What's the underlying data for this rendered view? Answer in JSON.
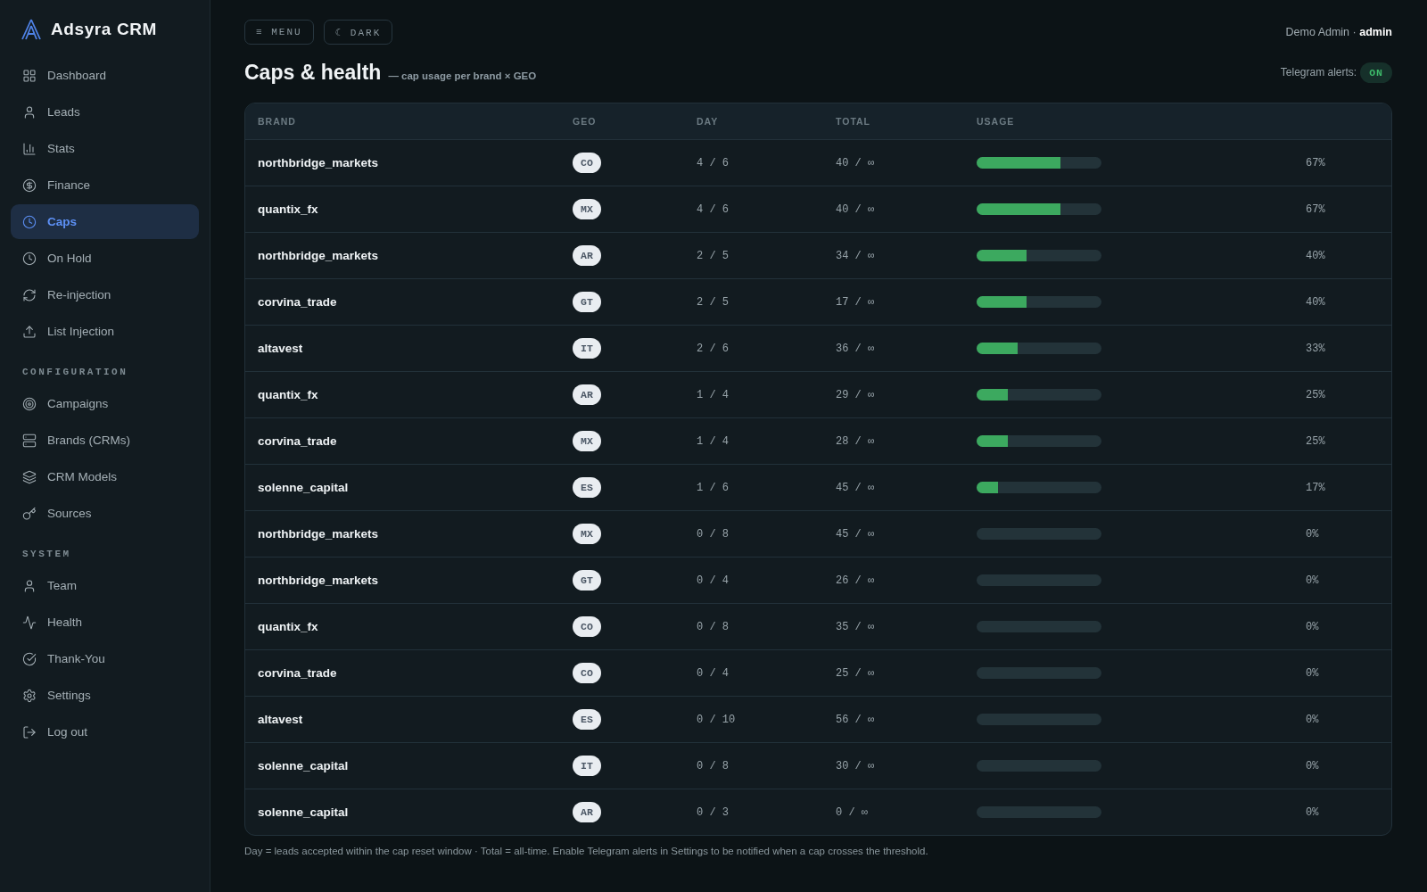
{
  "sidebar": {
    "brand": "Adsyra CRM",
    "items": [
      {
        "label": "Dashboard",
        "selected": false
      },
      {
        "label": "Leads",
        "selected": false
      },
      {
        "label": "Stats",
        "selected": false
      },
      {
        "label": "Finance",
        "selected": false
      },
      {
        "label": "Caps",
        "selected": true
      },
      {
        "label": "On Hold",
        "selected": false
      },
      {
        "label": "Re-injection",
        "selected": false
      },
      {
        "label": "List Injection",
        "selected": false
      }
    ],
    "sections": [
      {
        "title": "CONFIGURATION",
        "items": [
          {
            "label": "Campaigns",
            "selected": false
          },
          {
            "label": "Brands (CRMs)",
            "selected": false
          },
          {
            "label": "CRM Models",
            "selected": false
          },
          {
            "label": "Sources",
            "selected": false
          }
        ]
      },
      {
        "title": "SYSTEM",
        "items": [
          {
            "label": "Team",
            "selected": false
          },
          {
            "label": "Health",
            "selected": false
          },
          {
            "label": "Thank-You",
            "selected": false
          },
          {
            "label": "Settings",
            "selected": false
          },
          {
            "label": "Log out",
            "selected": false
          }
        ]
      }
    ]
  },
  "toolbar": {
    "buttons": [
      "≡ MENU",
      "☾ DARK"
    ],
    "user": "Demo Admin · **admin**"
  },
  "page": {
    "title": "Caps & health",
    "subtitle": "— cap usage per brand × GEO",
    "telegram_alerts": {
      "label": "Telegram alerts:",
      "badge": "ON",
      "on": true
    }
  },
  "table": {
    "columns": [
      "BRAND",
      "GEO",
      "DAY",
      "TOTAL",
      "USAGE"
    ],
    "rows": [
      {
        "brand": "northbridge_markets",
        "geo": "CO",
        "day": "4 / 6",
        "total": "40 / ∞",
        "level": 0.67,
        "percent": "67%"
      },
      {
        "brand": "quantix_fx",
        "geo": "MX",
        "day": "4 / 6",
        "total": "40 / ∞",
        "level": 0.67,
        "percent": "67%"
      },
      {
        "brand": "northbridge_markets",
        "geo": "AR",
        "day": "2 / 5",
        "total": "34 / ∞",
        "level": 0.4,
        "percent": "40%"
      },
      {
        "brand": "corvina_trade",
        "geo": "GT",
        "day": "2 / 5",
        "total": "17 / ∞",
        "level": 0.4,
        "percent": "40%"
      },
      {
        "brand": "altavest",
        "geo": "IT",
        "day": "2 / 6",
        "total": "36 / ∞",
        "level": 0.33,
        "percent": "33%"
      },
      {
        "brand": "quantix_fx",
        "geo": "AR",
        "day": "1 / 4",
        "total": "29 / ∞",
        "level": 0.25,
        "percent": "25%"
      },
      {
        "brand": "corvina_trade",
        "geo": "MX",
        "day": "1 / 4",
        "total": "28 / ∞",
        "level": 0.25,
        "percent": "25%"
      },
      {
        "brand": "solenne_capital",
        "geo": "ES",
        "day": "1 / 6",
        "total": "45 / ∞",
        "level": 0.17,
        "percent": "17%"
      },
      {
        "brand": "northbridge_markets",
        "geo": "MX",
        "day": "0 / 8",
        "total": "45 / ∞",
        "level": 0,
        "percent": "0%"
      },
      {
        "brand": "northbridge_markets",
        "geo": "GT",
        "day": "0 / 4",
        "total": "26 / ∞",
        "level": 0,
        "percent": "0%"
      },
      {
        "brand": "quantix_fx",
        "geo": "CO",
        "day": "0 / 8",
        "total": "35 / ∞",
        "level": 0,
        "percent": "0%"
      },
      {
        "brand": "corvina_trade",
        "geo": "CO",
        "day": "0 / 4",
        "total": "25 / ∞",
        "level": 0,
        "percent": "0%"
      },
      {
        "brand": "altavest",
        "geo": "ES",
        "day": "0 / 10",
        "total": "56 / ∞",
        "level": 0,
        "percent": "0%"
      },
      {
        "brand": "solenne_capital",
        "geo": "IT",
        "day": "0 / 8",
        "total": "30 / ∞",
        "level": 0,
        "percent": "0%"
      },
      {
        "brand": "solenne_capital",
        "geo": "AR",
        "day": "0 / 3",
        "total": "0 / ∞",
        "level": 0,
        "percent": "0%"
      }
    ]
  },
  "footnote": "Day = leads accepted within the cap reset window · Total = all-time. Enable Telegram alerts in Settings to be notified when a cap crosses the threshold."
}
